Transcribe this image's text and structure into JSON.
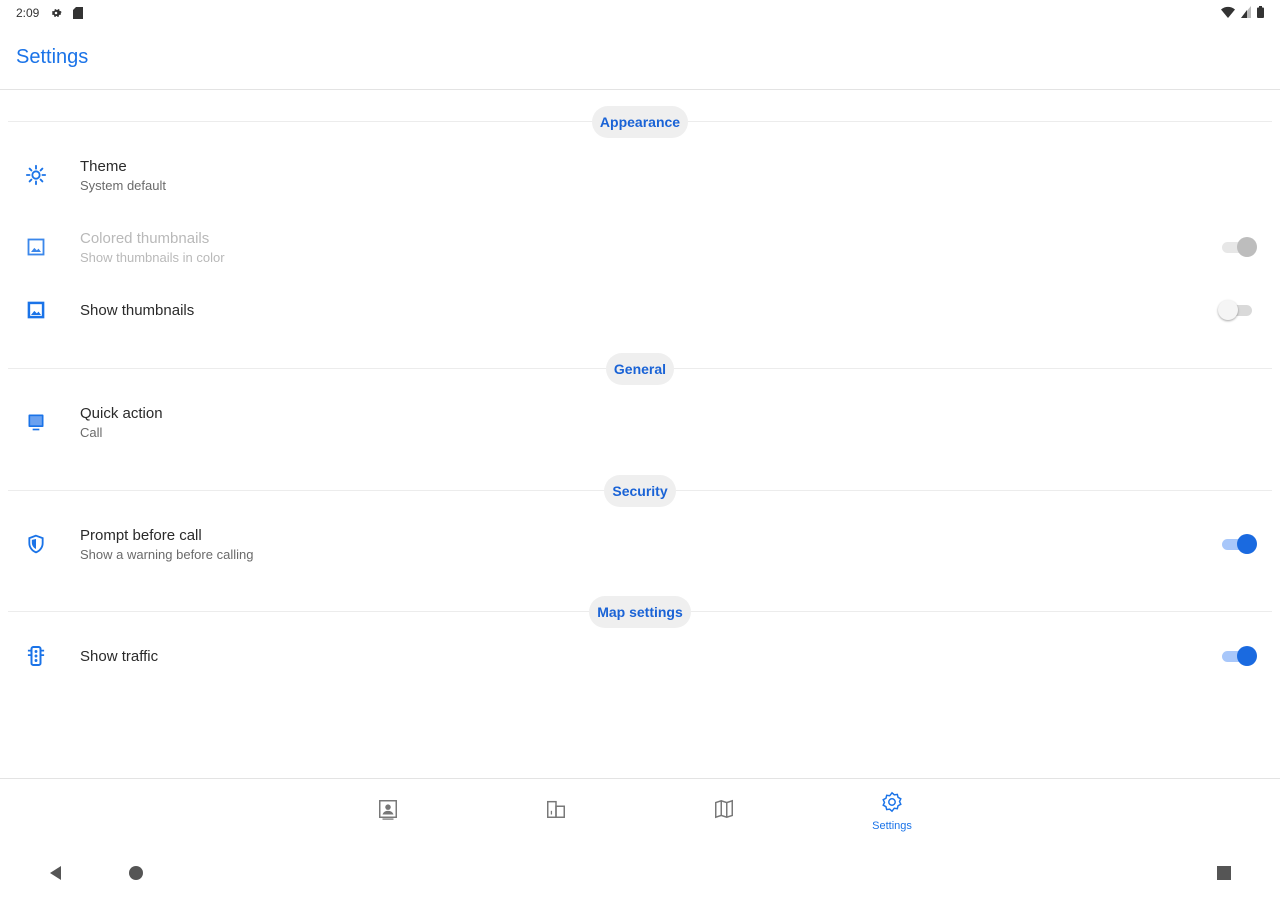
{
  "status_bar": {
    "time": "2:09",
    "icons": [
      "settings-icon",
      "sim-card-icon",
      "wifi-icon",
      "signal-icon",
      "battery-icon"
    ]
  },
  "app_bar": {
    "title": "Settings"
  },
  "sections": {
    "appearance": "Appearance",
    "general": "General",
    "security": "Security",
    "map": "Map settings"
  },
  "rows": {
    "theme": {
      "label": "Theme",
      "sub": "System default",
      "icon": "brightness-icon"
    },
    "colored_thumbnails": {
      "label": "Colored thumbnails",
      "sub": "Show thumbnails in color",
      "icon": "image-outline-icon",
      "enabled": false,
      "on": true
    },
    "show_thumbnails": {
      "label": "Show thumbnails",
      "icon": "image-icon",
      "on": false
    },
    "quick_action": {
      "label": "Quick action",
      "sub": "Call",
      "icon": "quick-action-icon"
    },
    "prompt_before_call": {
      "label": "Prompt before call",
      "sub": "Show a warning before calling",
      "icon": "shield-icon",
      "on": true
    },
    "show_traffic": {
      "label": "Show traffic",
      "icon": "traffic-icon",
      "on": true
    }
  },
  "bottom_nav": {
    "items": [
      {
        "icon": "contacts-icon",
        "label": ""
      },
      {
        "icon": "buildings-icon",
        "label": ""
      },
      {
        "icon": "map-icon",
        "label": ""
      },
      {
        "icon": "settings-icon",
        "label": "Settings",
        "active": true
      }
    ]
  },
  "system_nav": [
    "back-icon",
    "home-icon",
    "recents-icon"
  ],
  "colors": {
    "accent": "#1a73e8",
    "chip_bg": "#efefef",
    "switch_on": "#1a6ae0"
  }
}
